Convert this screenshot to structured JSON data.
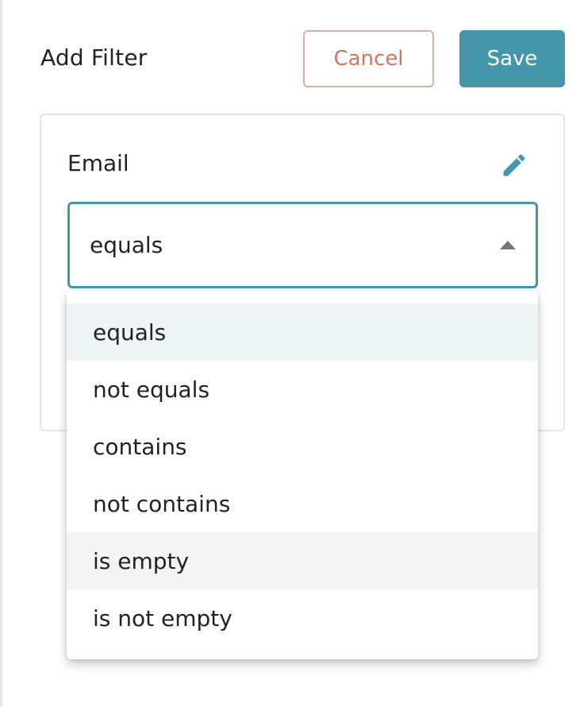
{
  "header": {
    "title": "Add Filter",
    "cancel_label": "Cancel",
    "save_label": "Save"
  },
  "filter": {
    "field_label": "Email",
    "edit_icon": "pencil-icon",
    "operator_selected": "equals",
    "dropdown_icon": "caret-up-icon",
    "options": [
      {
        "label": "equals",
        "state": "selected"
      },
      {
        "label": "not equals",
        "state": "normal"
      },
      {
        "label": "contains",
        "state": "normal"
      },
      {
        "label": "not contains",
        "state": "normal"
      },
      {
        "label": "is empty",
        "state": "hover"
      },
      {
        "label": "is not empty",
        "state": "normal"
      }
    ]
  },
  "colors": {
    "primary": "#4497a8",
    "cancel_text": "#d7735b",
    "cancel_border": "#e0ac9b",
    "selected_bg": "#eff5f7",
    "hover_bg": "#f4f4f4"
  }
}
